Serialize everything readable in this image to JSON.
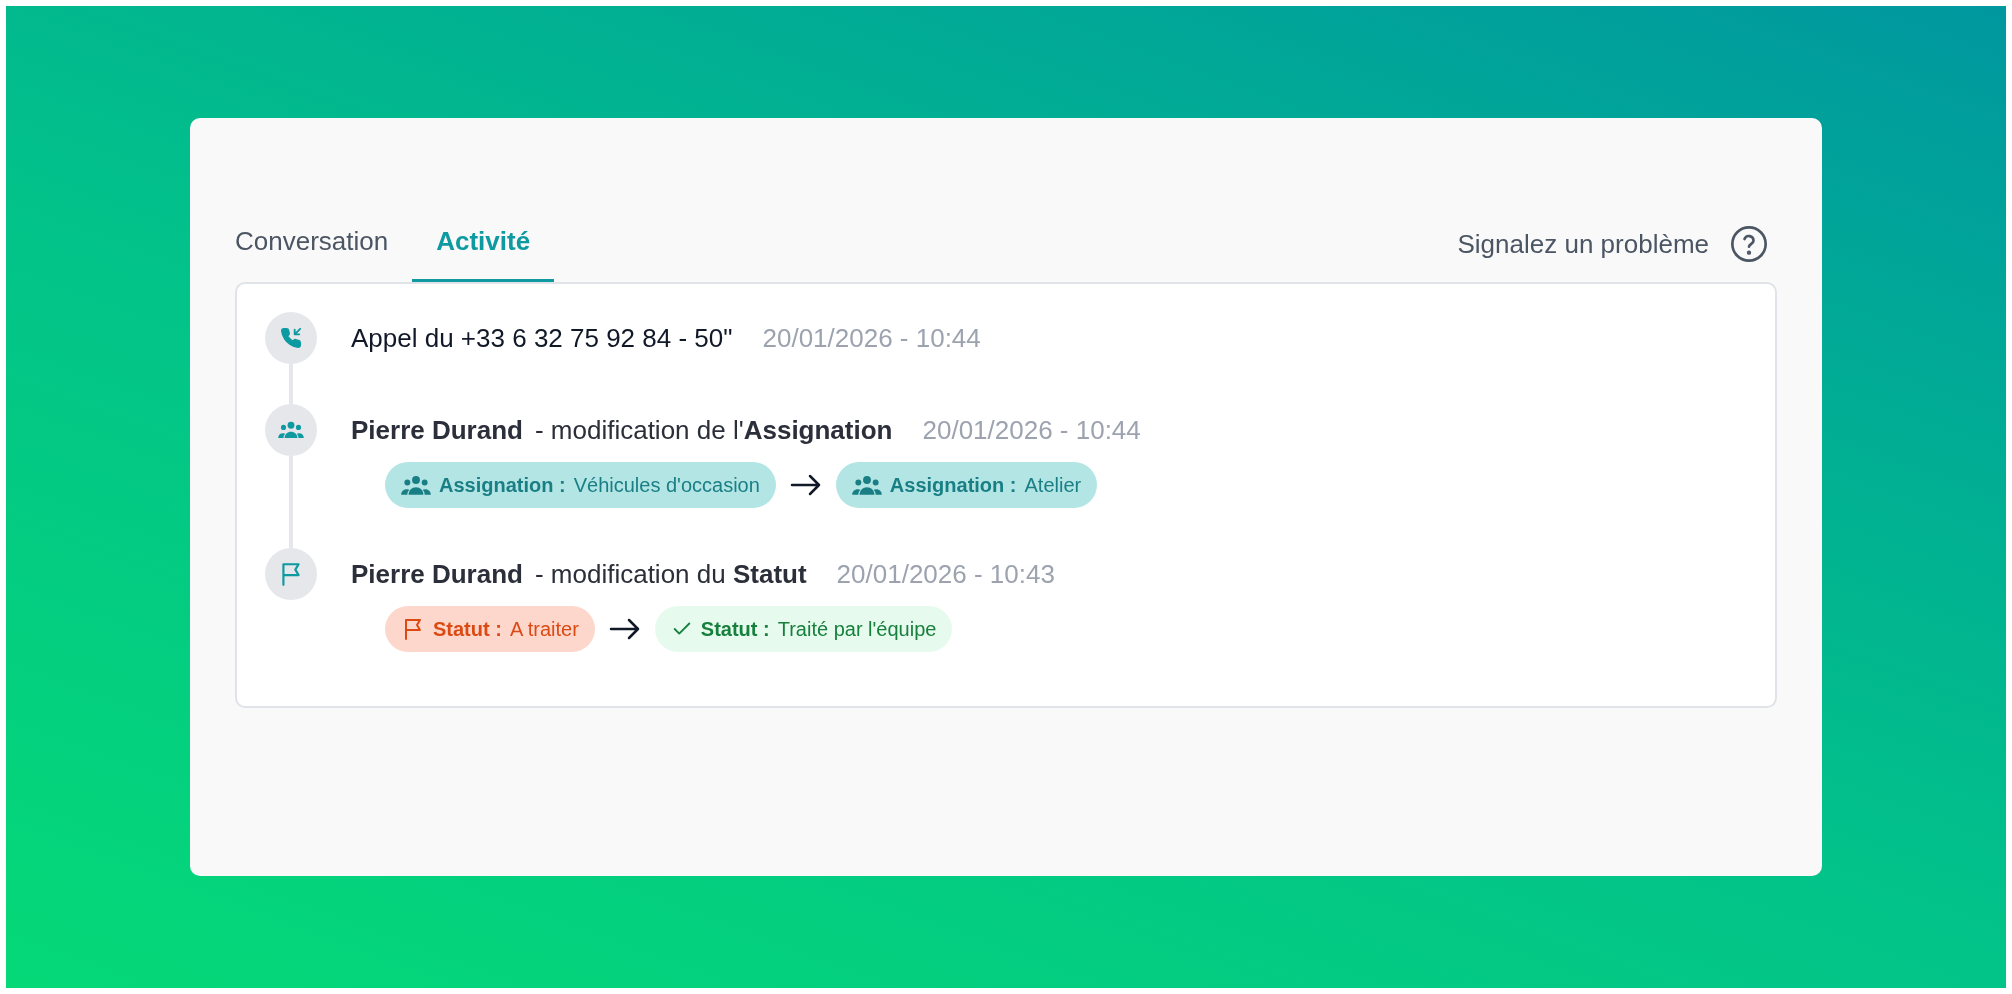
{
  "tabs": [
    {
      "label": "Conversation",
      "selected": false
    },
    {
      "label": "Activité",
      "selected": true
    }
  ],
  "report_link": {
    "label": "Signalez un problème"
  },
  "events": [
    {
      "kind": "call",
      "text": "Appel du +33 6 32 75 92 84 - 50\"",
      "time": "20/01/2026 - 10:44"
    },
    {
      "kind": "assignment",
      "author": "Pierre Durand",
      "action": "- modification de l'**Assignation**",
      "time": "20/01/2026 - 10:44",
      "from": {
        "kind": "assignment",
        "label": "Assignation :",
        "value": "Véhicules d'occasion"
      },
      "to": {
        "kind": "assignment",
        "label": "Assignation :",
        "value": "Atelier"
      }
    },
    {
      "kind": "status",
      "author": "Pierre Durand",
      "action": "- modification du **Statut**",
      "time": "20/01/2026 - 10:43",
      "from": {
        "kind": "todo",
        "label": "Statut :",
        "value": "A traiter"
      },
      "to": {
        "kind": "done",
        "label": "Statut :",
        "value": "Traité par l'équipe"
      }
    }
  ]
}
